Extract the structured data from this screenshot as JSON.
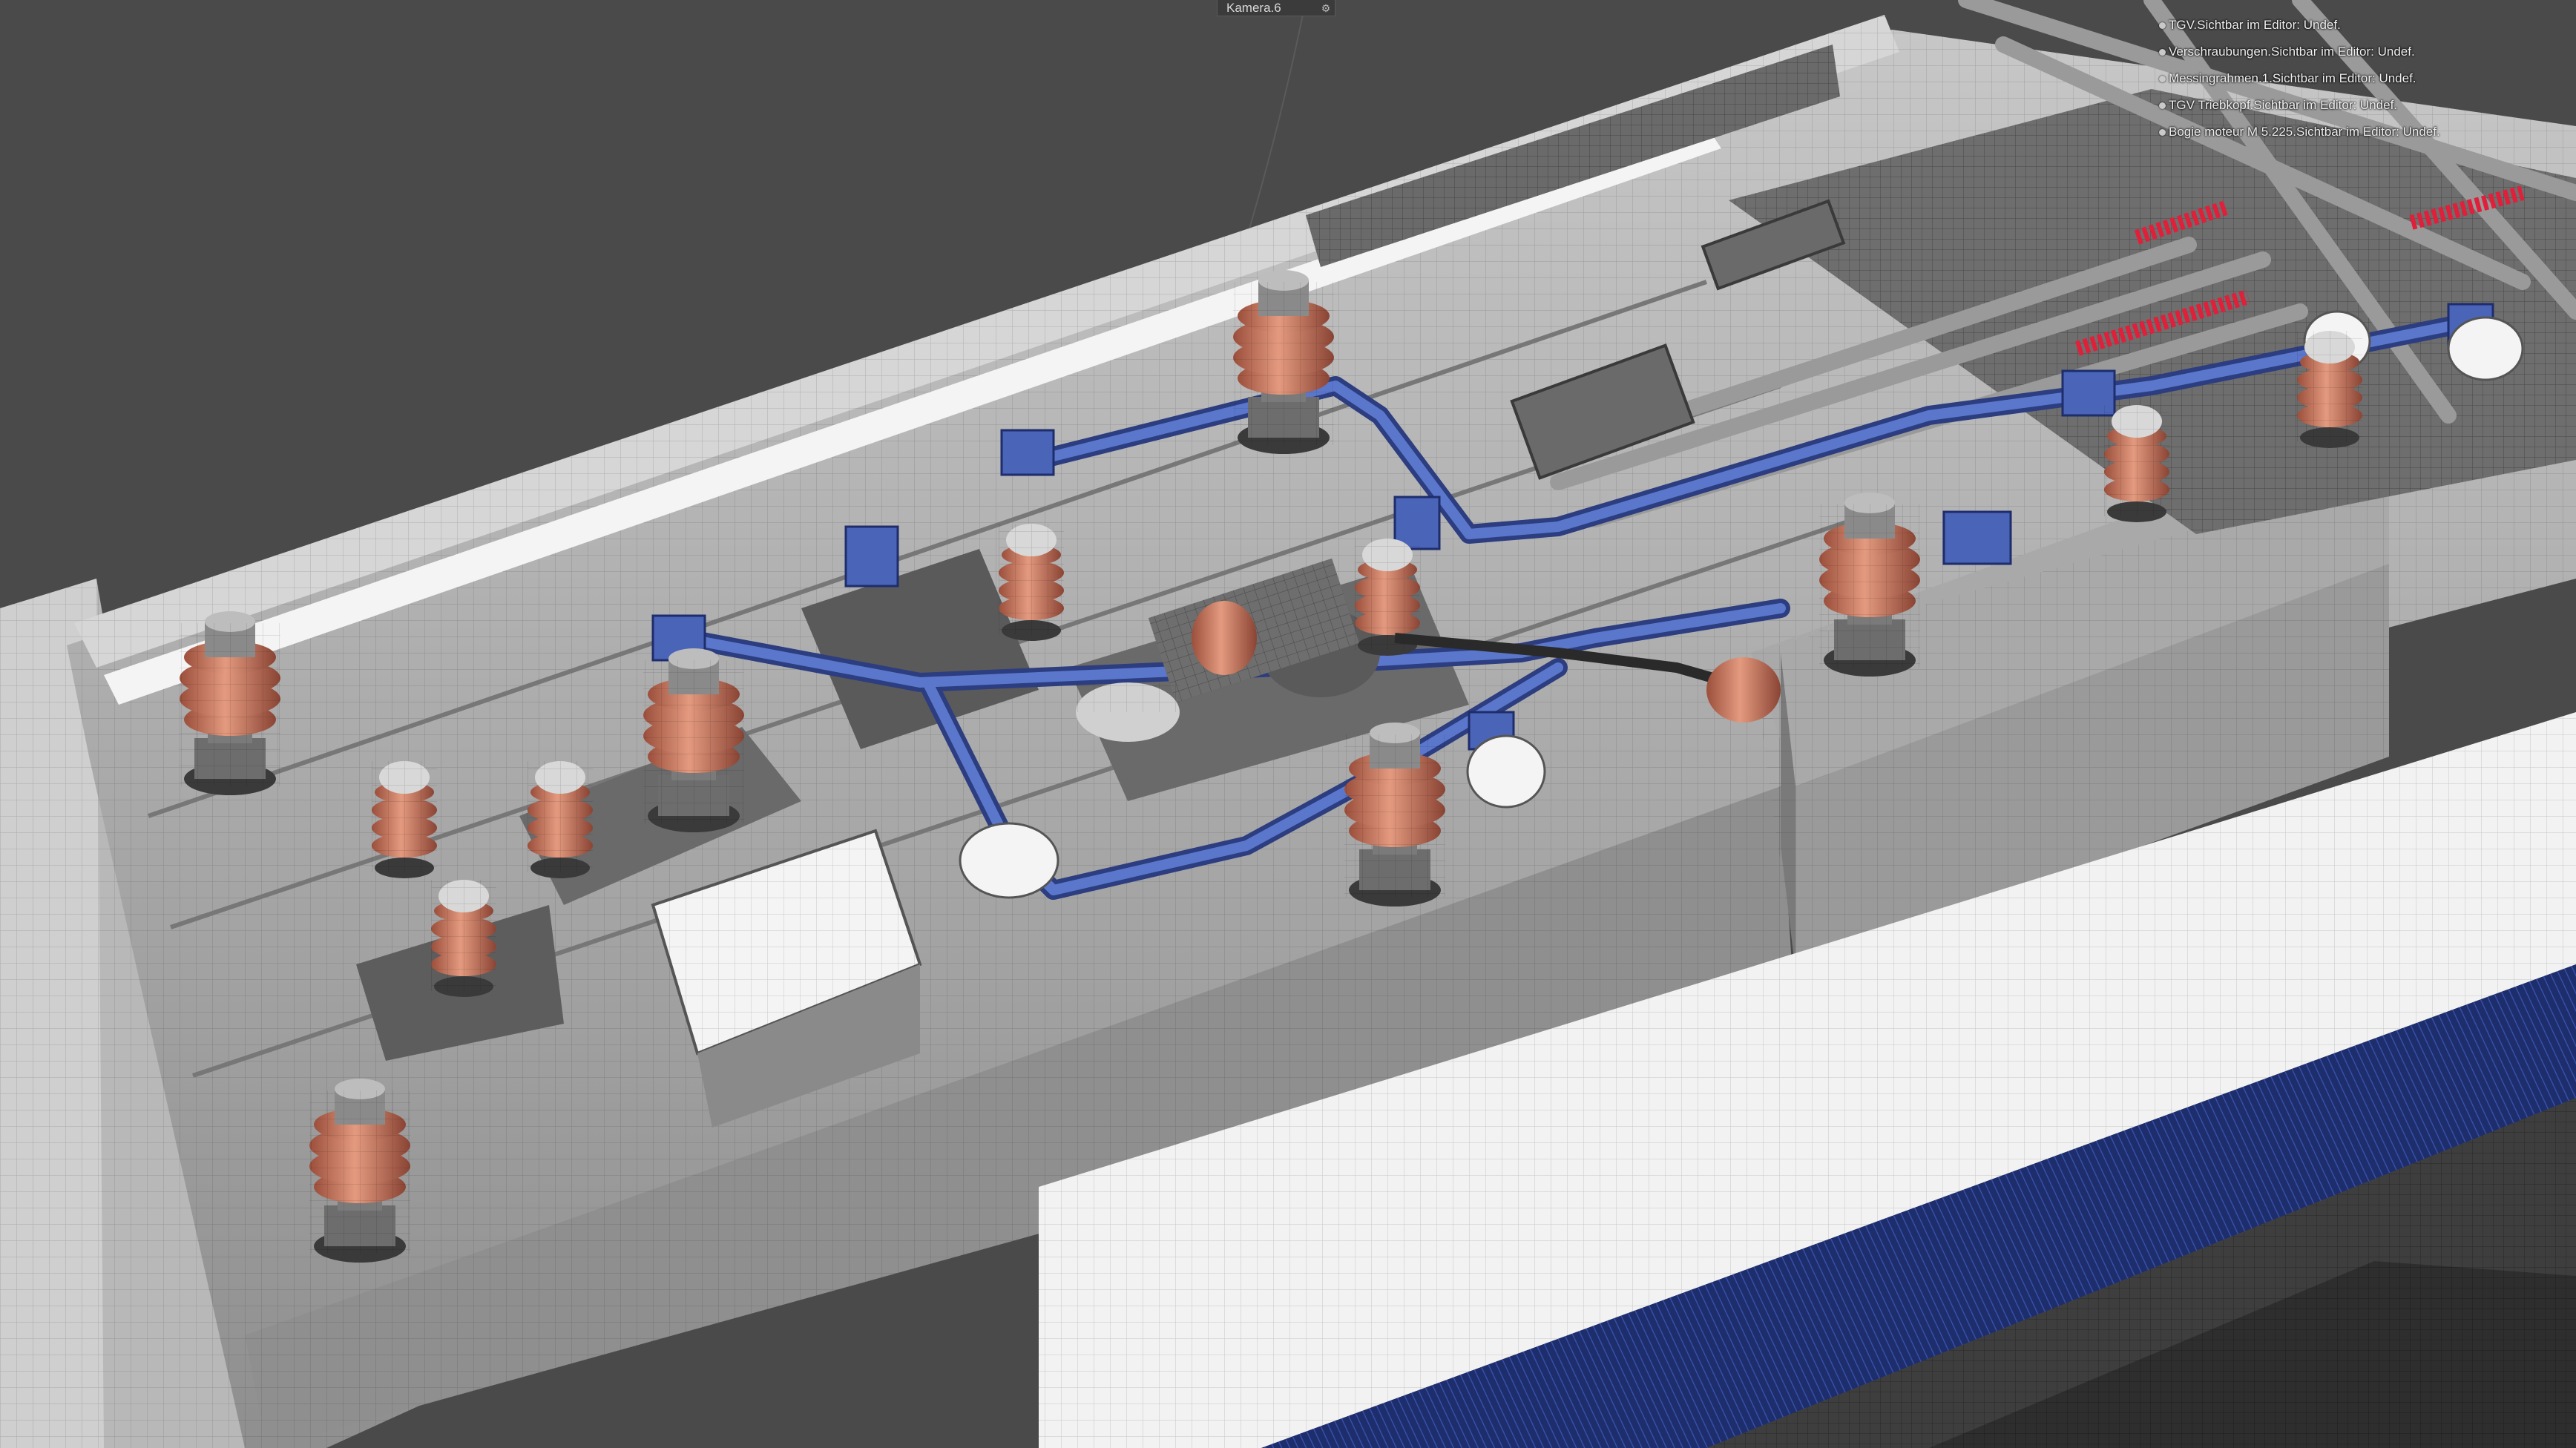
{
  "camera": {
    "label": "Kamera.6",
    "icon": "camera-options-icon"
  },
  "hud": {
    "lines": [
      "TGV.Sichtbar im Editor: Undef.",
      "Verschraubungen.Sichtbar im Editor: Undef.",
      "Messingrahmen.1.Sichtbar im Editor: Undef.",
      "TGV Triebkopf.Sichtbar im Editor: Undef.",
      "Bogie moteur M 5.225.Sichtbar im Editor: Undef."
    ]
  },
  "colors": {
    "background": "#4a4a4a",
    "body_grey": "#8c8c8c",
    "roof_light": "#b4b4b4",
    "white_panel": "#f2f2f2",
    "stripe_blue": "#1e2d6b",
    "insulator_copper": "#c8735a",
    "cable_blue": "#4a64b8",
    "spring_red": "#e0203a"
  }
}
